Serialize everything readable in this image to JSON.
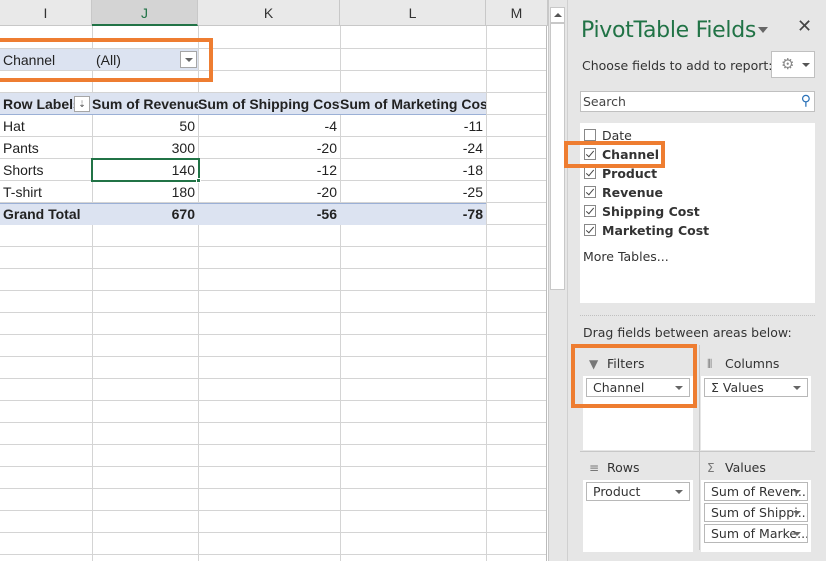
{
  "sheet": {
    "columns": [
      "I",
      "J",
      "K",
      "L",
      "M"
    ],
    "selected_column": "J",
    "filter": {
      "field": "Channel",
      "value": "(All)"
    },
    "pivot": {
      "headers": [
        "Row Labels",
        "Sum of Revenue",
        "Sum of Shipping Cost",
        "Sum of Marketing Cost"
      ],
      "rows": [
        {
          "label": "Hat",
          "revenue": "50",
          "shipping": "-4",
          "marketing": "-11"
        },
        {
          "label": "Pants",
          "revenue": "300",
          "shipping": "-20",
          "marketing": "-24"
        },
        {
          "label": "Shorts",
          "revenue": "140",
          "shipping": "-12",
          "marketing": "-18"
        },
        {
          "label": "T-shirt",
          "revenue": "180",
          "shipping": "-20",
          "marketing": "-25"
        }
      ],
      "total": {
        "label": "Grand Total",
        "revenue": "670",
        "shipping": "-56",
        "marketing": "-78"
      }
    },
    "selected_cell": "J Shorts revenue (140)"
  },
  "pane": {
    "title": "PivotTable Fields",
    "choose_label": "Choose fields to add to report:",
    "search_placeholder": "Search",
    "fields": [
      {
        "name": "Date",
        "checked": false
      },
      {
        "name": "Channel",
        "checked": true
      },
      {
        "name": "Product",
        "checked": true
      },
      {
        "name": "Revenue",
        "checked": true
      },
      {
        "name": "Shipping Cost",
        "checked": true
      },
      {
        "name": "Marketing Cost",
        "checked": true
      }
    ],
    "more_tables": "More Tables...",
    "drag_label": "Drag fields between areas below:",
    "areas": {
      "filters": {
        "label": "Filters",
        "items": [
          "Channel"
        ]
      },
      "columns": {
        "label": "Columns",
        "items": [
          "Σ Values"
        ]
      },
      "rows": {
        "label": "Rows",
        "items": [
          "Product"
        ]
      },
      "values": {
        "label": "Values",
        "items": [
          "Sum of Reven...",
          "Sum of Shippi...",
          "Sum of Marke..."
        ]
      }
    }
  },
  "highlight_color": "#ee7d31",
  "accent_color": "#217346"
}
